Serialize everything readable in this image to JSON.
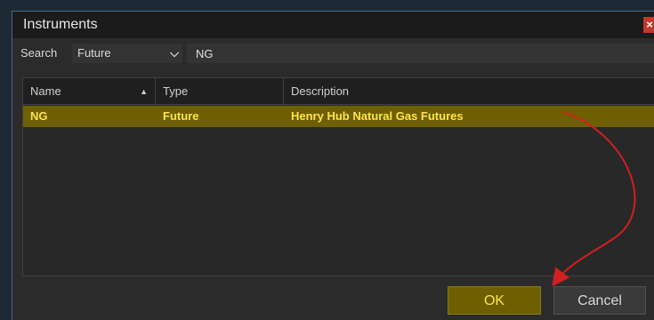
{
  "window": {
    "title": "Instruments",
    "close_glyph": "×"
  },
  "search": {
    "label": "Search",
    "type_value": "Future",
    "query_value": "NG"
  },
  "table": {
    "columns": [
      "Name",
      "Type",
      "Description"
    ],
    "rows": [
      {
        "name": "NG",
        "type": "Future",
        "description": "Henry Hub Natural Gas Futures"
      }
    ]
  },
  "buttons": {
    "ok": "OK",
    "cancel": "Cancel"
  },
  "icons": {
    "sort": "sort-ascending-icon",
    "dropdown": "chevron-down-icon",
    "close": "close-icon"
  },
  "colors": {
    "highlight_bg": "#6e6000",
    "highlight_text": "#ffe14a",
    "annotation": "#d02020"
  }
}
